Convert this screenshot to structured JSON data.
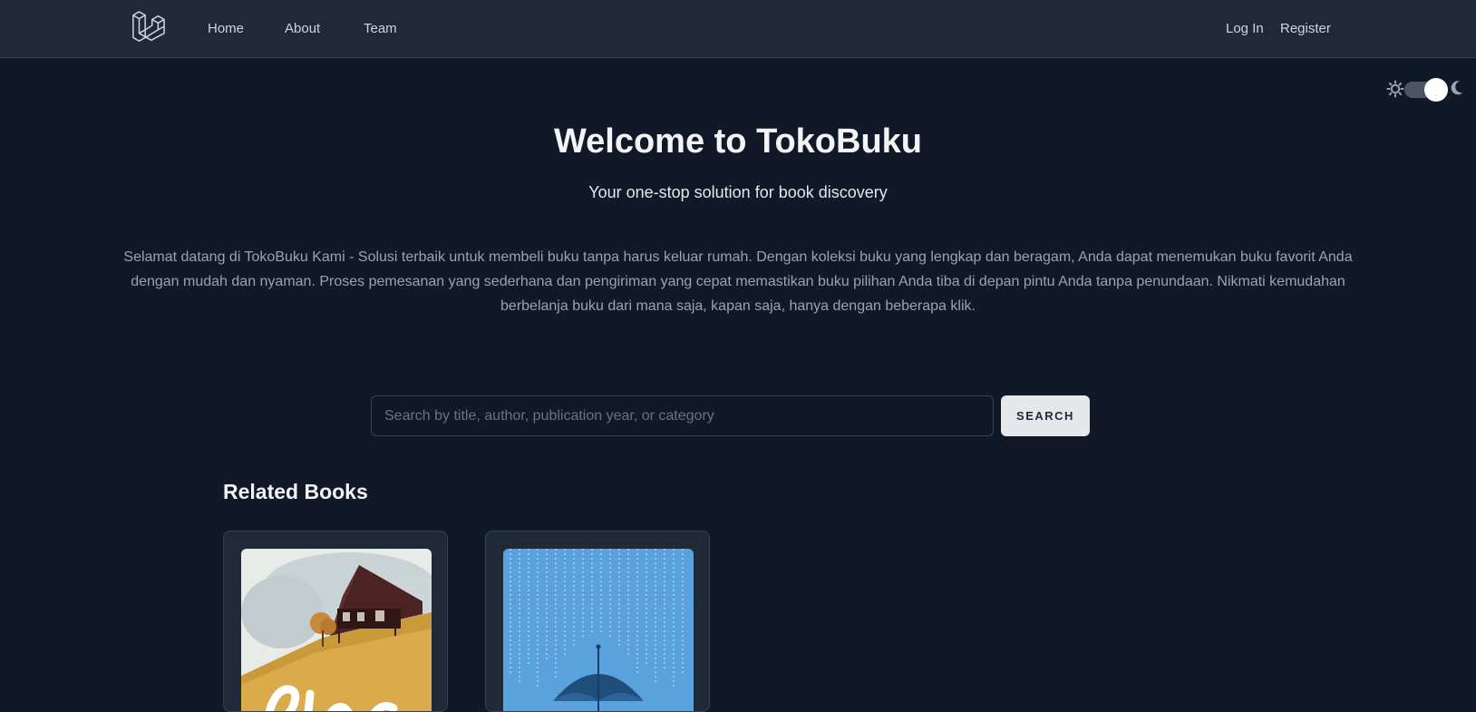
{
  "nav": {
    "links": [
      {
        "label": "Home"
      },
      {
        "label": "About"
      },
      {
        "label": "Team"
      }
    ],
    "auth": {
      "login_label": "Log In",
      "register_label": "Register"
    }
  },
  "theme_toggle": {
    "mode": "dark",
    "icons": [
      "sun-icon",
      "moon-icon"
    ]
  },
  "hero": {
    "title": "Welcome to TokoBuku",
    "subtitle": "Your one-stop solution for book discovery",
    "description": "Selamat datang di TokoBuku Kami - Solusi terbaik untuk membeli buku tanpa harus keluar rumah. Dengan koleksi buku yang lengkap dan beragam, Anda dapat menemukan buku favorit Anda dengan mudah dan nyaman. Proses pemesanan yang sederhana dan pengiriman yang cepat memastikan buku pilihan Anda tiba di depan pintu Anda tanpa penundaan. Nikmati kemudahan berbelanja buku dari mana saja, kapan saja, hanya dengan beberapa klik."
  },
  "search": {
    "placeholder": "Search by title, author, publication year, or category",
    "value": "",
    "button_label": "SEARCH"
  },
  "related": {
    "title": "Related Books",
    "books": [
      {
        "cover_art": "hillside-house-cover"
      },
      {
        "cover_art": "umbrella-rain-cover"
      }
    ]
  },
  "colors": {
    "background": "#111827",
    "navbar": "#1f2937",
    "card": "#1f2937",
    "border": "#374151",
    "button_bg": "#e5e7eb"
  }
}
